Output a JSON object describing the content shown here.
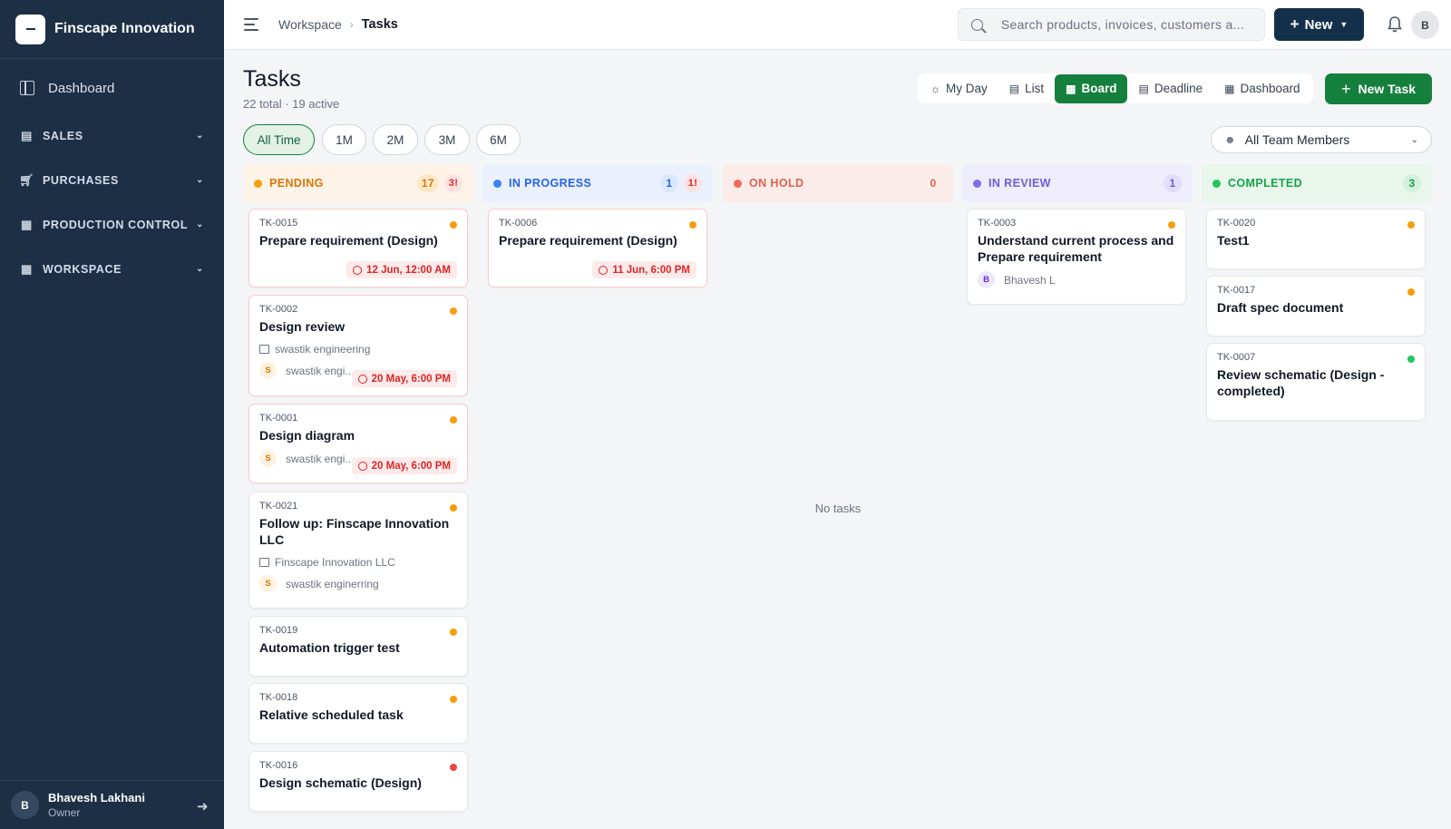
{
  "app": {
    "name": "Finscape Innovation"
  },
  "sidebar": {
    "dashboard": "Dashboard",
    "sections": [
      {
        "label": "SALES",
        "icon": "sales-icon"
      },
      {
        "label": "PURCHASES",
        "icon": "cart-icon"
      },
      {
        "label": "PRODUCTION CONTROL",
        "icon": "factory-icon"
      },
      {
        "label": "WORKSPACE",
        "icon": "workspace-icon"
      }
    ],
    "user": {
      "initial": "B",
      "name": "Bhavesh Lakhani",
      "role": "Owner"
    }
  },
  "topbar": {
    "breadcrumb": [
      "Workspace",
      "Tasks"
    ],
    "search_placeholder": "Search products, invoices, customers a...",
    "new_label": "New",
    "avatar_initial": "B"
  },
  "page": {
    "title": "Tasks",
    "subtitle": "22 total · 19 active",
    "views": [
      "My Day",
      "List",
      "Board",
      "Deadline",
      "Dashboard"
    ],
    "active_view": "Board",
    "new_task_label": "New Task",
    "ranges": [
      "All Time",
      "1M",
      "2M",
      "3M",
      "6M"
    ],
    "active_range": "All Time",
    "members_filter": "All Team Members"
  },
  "colors": {
    "pending": "#f59e0b",
    "in_progress": "#3b82f6",
    "on_hold": "#ef6b5b",
    "in_review": "#7c6ee6",
    "completed": "#22c55e",
    "high_priority": "#ef4444",
    "accent": "#15803d"
  },
  "columns": [
    {
      "key": "pending",
      "label": "PENDING",
      "count": "17",
      "overdue": "3!"
    },
    {
      "key": "in_progress",
      "label": "IN PROGRESS",
      "count": "1",
      "overdue": "1!"
    },
    {
      "key": "on_hold",
      "label": "ON HOLD",
      "count": "0",
      "empty": "No tasks"
    },
    {
      "key": "in_review",
      "label": "IN REVIEW",
      "count": "1"
    },
    {
      "key": "completed",
      "label": "COMPLETED",
      "count": "3"
    }
  ],
  "cards": {
    "pending": [
      {
        "id": "TK-0015",
        "title": "Prepare requirement (Design)",
        "due": "12 Jun, 12:00 AM"
      },
      {
        "id": "TK-0002",
        "title": "Design review",
        "company": "swastik engineering",
        "assignee_initial": "S",
        "assignee": "swastik engi...",
        "due": "20 May, 6:00 PM"
      },
      {
        "id": "TK-0001",
        "title": "Design diagram",
        "assignee_initial": "S",
        "assignee": "swastik engi...",
        "due": "20 May, 6:00 PM"
      },
      {
        "id": "TK-0021",
        "title": "Follow up: Finscape Innovation LLC",
        "company": "Finscape Innovation LLC",
        "assignee_initial": "S",
        "assignee": "swastik enginerring"
      },
      {
        "id": "TK-0019",
        "title": "Automation trigger test"
      },
      {
        "id": "TK-0018",
        "title": "Relative scheduled task"
      },
      {
        "id": "TK-0016",
        "title": "Design schematic (Design)"
      }
    ],
    "in_progress": [
      {
        "id": "TK-0006",
        "title": "Prepare requirement (Design)",
        "due": "11 Jun, 6:00 PM"
      }
    ],
    "in_review": [
      {
        "id": "TK-0003",
        "title": "Understand current process and Prepare requirement",
        "assignee_initial": "B",
        "assignee": "Bhavesh L"
      }
    ],
    "completed": [
      {
        "id": "TK-0020",
        "title": "Test1"
      },
      {
        "id": "TK-0017",
        "title": "Draft spec document"
      },
      {
        "id": "TK-0007",
        "title": "Review schematic (Design - completed)"
      }
    ]
  }
}
